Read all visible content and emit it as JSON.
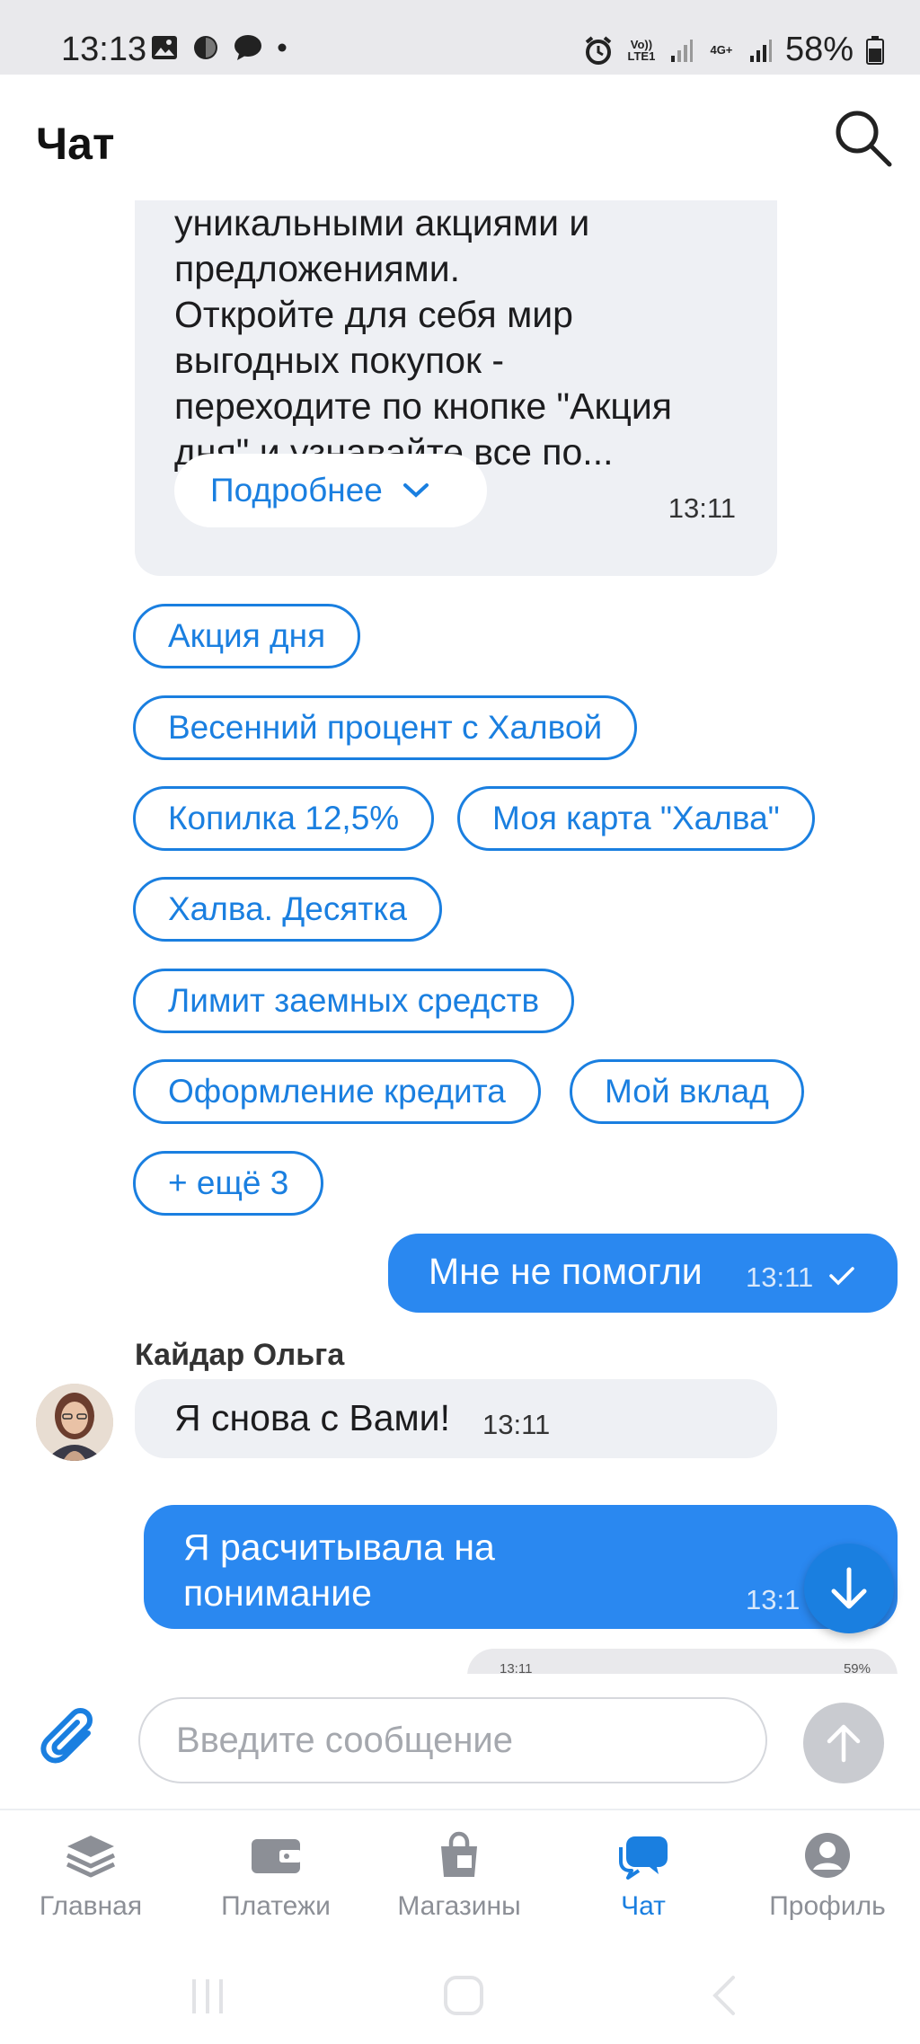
{
  "status_bar": {
    "time": "13:13",
    "battery": "58%",
    "volte_label": "Vo)) LTE1",
    "net_label": "4G+"
  },
  "header": {
    "title": "Чат"
  },
  "messages": {
    "bot_message": {
      "lines": [
        "уникальными акциями и",
        "предложениями.",
        "Откройте для себя мир",
        "выгодных покупок -",
        "переходите по кнопке \"Акция",
        "дня\" и узнавайте все по..."
      ],
      "more_label": "Подробнее",
      "time": "13:11"
    },
    "quick_replies": [
      "Акция дня",
      "Весенний процент с Халвой",
      "Копилка 12,5%",
      "Моя карта \"Халва\"",
      "Халва. Десятка",
      "Лимит заемных средств",
      "Оформление кредита",
      "Мой вклад",
      "+ ещё 3"
    ],
    "user_message_1": {
      "text": "Мне не помогли",
      "time": "13:11"
    },
    "operator": {
      "name": "Кайдар Ольга",
      "text": "Я снова с Вами!",
      "time": "13:11"
    },
    "user_message_2": {
      "line1": "Я расчитывала на",
      "line2": "понимание",
      "time": "13:1"
    },
    "partial_preview": {
      "time": "13:11",
      "battery": "59%"
    }
  },
  "composer": {
    "placeholder": "Введите сообщение"
  },
  "bottom_nav": {
    "items": [
      {
        "label": "Главная",
        "icon": "layers-icon"
      },
      {
        "label": "Платежи",
        "icon": "wallet-icon"
      },
      {
        "label": "Магазины",
        "icon": "shopping-bag-icon"
      },
      {
        "label": "Чат",
        "icon": "chat-bubbles-icon",
        "active": true
      },
      {
        "label": "Профиль",
        "icon": "profile-icon"
      }
    ]
  },
  "colors": {
    "accent": "#1a7fe0",
    "user_bubble": "#2a88f0",
    "incoming_bubble": "#eef0f4",
    "inactive": "#8c8f96"
  }
}
